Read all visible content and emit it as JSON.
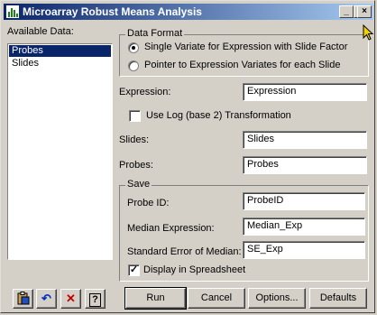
{
  "window": {
    "title": "Microarray Robust Means Analysis",
    "minimize": "_",
    "maximize": "□",
    "close": "×"
  },
  "available": {
    "label": "Available Data:",
    "items": [
      "Probes",
      "Slides"
    ]
  },
  "data_format": {
    "title": "Data Format",
    "option1": "Single Variate for Expression with Slide Factor",
    "option2": "Pointer to Expression Variates for each Slide"
  },
  "expression": {
    "label": "Expression:",
    "value": "Expression"
  },
  "use_log": {
    "label": "Use Log (base 2) Transformation",
    "checked": false
  },
  "slides": {
    "label": "Slides:",
    "value": "Slides"
  },
  "probes": {
    "label": "Probes:",
    "value": "Probes"
  },
  "save": {
    "title": "Save",
    "probe_id_label": "Probe ID:",
    "probe_id_value": "ProbeID",
    "median_label": "Median Expression:",
    "median_value": "Median_Exp",
    "se_label": "Standard Error of Median:",
    "se_value": "SE_Exp",
    "display_label": "Display in Spreadsheet",
    "display_checked": true
  },
  "buttons": {
    "run": "Run",
    "cancel": "Cancel",
    "options": "Options...",
    "defaults": "Defaults"
  },
  "icons": [
    "clipboard-icon",
    "undo-icon",
    "clear-icon",
    "help-icon"
  ],
  "colors": {
    "titlebar_start": "#0a246a",
    "titlebar_end": "#a6caf0",
    "selection": "#0a246a",
    "face": "#d4d0c8"
  }
}
